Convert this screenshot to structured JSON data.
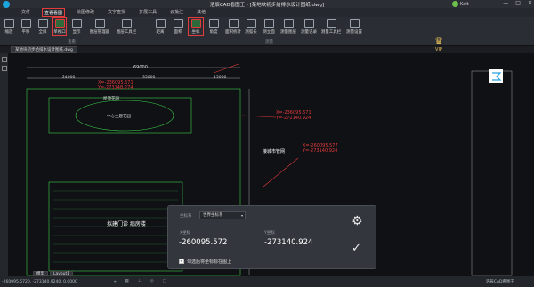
{
  "app": {
    "title": "浩辰CAD看图王 - [某地块初步给排水设计图纸.dwg]",
    "user": "Kait",
    "win_controls": [
      "—",
      "□",
      "✕"
    ]
  },
  "menu": {
    "tabs": [
      "文件",
      "查看看图",
      "绘图修改",
      "文字查找",
      "扩展工具",
      "云批注",
      "其他"
    ]
  },
  "ribbon": {
    "view_tools": [
      "缩放",
      "平移",
      "全屏",
      "单视口",
      "显示",
      "图层管理器",
      "图层工具栏"
    ],
    "measure_tools": [
      "距离",
      "面积",
      "坐标",
      "角度",
      "面积统计",
      "测弧长",
      "测立面",
      "测量图层",
      "测量记录",
      "测量工具栏",
      "测量设置"
    ],
    "group_view": "查看",
    "group_measure": "测量",
    "vip": "VIP"
  },
  "doc_tab": "某地块初步给排水设计图纸.dwg",
  "drawing": {
    "dim_top": "69000",
    "dim_sub": [
      "24000",
      "35000",
      "15000"
    ],
    "label_garden": "屋顶花园",
    "label_center": "中心主题花园",
    "label_pipe": "接城市管网",
    "label_building": "拟建门诊 病房楼",
    "red_1": "X=-236095.571\nY=-27314B.274",
    "red_2": "X=-236095.571\nY=-272140.924",
    "red_3": "X=-260095.577\nY=-273140.924"
  },
  "panel": {
    "system_label": "坐标系",
    "system_value": "世界坐标系",
    "x_label": "X坐标",
    "y_label": "Y坐标",
    "x_value": "-260095.572",
    "y_value": "-273140.924",
    "checkbox_label": "勾选后将坐标标在图上",
    "checkbox_mark": "✓"
  },
  "status": {
    "coords": "-260095.5720, -273140.9240, 0.0000",
    "model_tab": "模型",
    "layout_tab": "Layout1",
    "brand": "浩辰CAD看图王"
  },
  "colors": {
    "accent_red": "#e23b3b",
    "drawing_green": "#3fd14a",
    "background": "#0f1115"
  }
}
